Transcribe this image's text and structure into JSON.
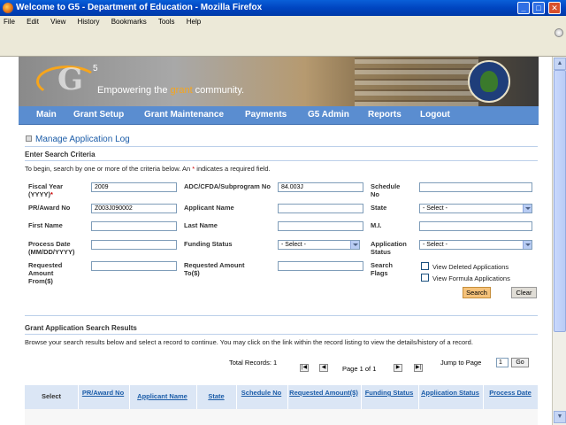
{
  "window": {
    "title": "Welcome to G5 - Department of Education - Mozilla Firefox",
    "controls": [
      "_",
      "□",
      "✕"
    ]
  },
  "menubar": [
    "File",
    "Edit",
    "View",
    "History",
    "Bookmarks",
    "Tools",
    "Help"
  ],
  "banner": {
    "logo_text": "G",
    "logo_sup": "5",
    "tagline_pre": "Empowering the ",
    "tagline_accent": "grant",
    "tagline_post": " community."
  },
  "nav": [
    "Main",
    "Grant Setup",
    "Grant Maintenance",
    "Payments",
    "G5 Admin",
    "Reports",
    "Logout"
  ],
  "page": {
    "title": "Manage Application Log",
    "section_title": "Enter Search Criteria",
    "intro_pre": "To begin, search by one or more of the criteria below. An ",
    "intro_star": "*",
    "intro_post": " indicates a required field."
  },
  "form": {
    "fiscal_year_label": "Fiscal Year (YYYY)",
    "fiscal_year_req": "*",
    "fiscal_year_value": "2009",
    "adc_label": "ADC/CFDA/Subprogram No",
    "adc_value": "84.003J",
    "schedule_label": "Schedule No",
    "schedule_value": "",
    "pr_award_label": "PR/Award No",
    "pr_award_value": "Z003J090002",
    "applicant_name_label": "Applicant Name",
    "applicant_name_value": "",
    "state_label": "State",
    "state_value": "- Select -",
    "first_name_label": "First Name",
    "last_name_label": "Last Name",
    "mi_label": "M.I.",
    "process_date_label": "Process Date (MM/DD/YYYY)",
    "funding_status_label": "Funding Status",
    "funding_status_value": "- Select -",
    "application_status_label": "Application Status",
    "application_status_value": "- Select -",
    "req_amount_from_label": "Requested Amount From($)",
    "req_amount_to_label": "Requested Amount To($)",
    "search_flags_label": "Search Flags",
    "view_deleted_label": "View Deleted Applications",
    "view_formula_label": "View Formula Applications",
    "search_button": "Search",
    "clear_button": "Clear"
  },
  "results": {
    "title": "Grant Application Search Results",
    "browse_text": "Browse your search results below and select a record to continue. You may click on the link within the record listing to view the details/history of a record.",
    "total_records": "Total Records: 1",
    "page_info": "Page 1 of 1",
    "jump_label": "Jump to Page",
    "jump_value": "1",
    "go_button": "Go",
    "columns": [
      "Select",
      "PR/Award No",
      "Applicant Name",
      "State",
      "Schedule No",
      "Requested Amount($)",
      "Funding Status",
      "Application Status",
      "Process Date"
    ]
  }
}
